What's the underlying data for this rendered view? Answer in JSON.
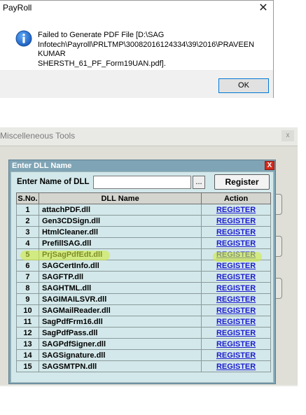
{
  "message_box": {
    "title": "PayRoll",
    "close_glyph": "✕",
    "icon": "info-icon",
    "message_line1": "Failed to Generate PDF File [D:\\SAG",
    "message_line2": "Infotech\\Payroll\\PRLTMP\\30082016124334\\39\\2016\\PRAVEEN KUMAR",
    "message_line3": "SHERSTH_61_PF_Form19UAN.pdf].",
    "ok_label": "OK"
  },
  "misc_window": {
    "title": "Miscelleneous Tools",
    "close_glyph": "x"
  },
  "dll_dialog": {
    "title": "Enter DLL Name",
    "close_glyph": "X",
    "input_label": "Enter Name of DLL",
    "input_value": "",
    "browse_label": "...",
    "register_button_label": "Register",
    "columns": [
      "S.No.",
      "DLL Name",
      "Action"
    ],
    "rows": [
      {
        "sno": "1",
        "name": "attachPDF.dll",
        "action": "REGISTER"
      },
      {
        "sno": "2",
        "name": "Gen3CDSign.dll",
        "action": "REGISTER"
      },
      {
        "sno": "3",
        "name": "HtmlCleaner.dll",
        "action": "REGISTER"
      },
      {
        "sno": "4",
        "name": "PrefillSAG.dll",
        "action": "REGISTER"
      },
      {
        "sno": "5",
        "name": "PrjSagPdfEdt.dll",
        "action": "REGISTER"
      },
      {
        "sno": "6",
        "name": "SAGCertInfo.dll",
        "action": "REGISTER"
      },
      {
        "sno": "7",
        "name": "SAGFTP.dll",
        "action": "REGISTER"
      },
      {
        "sno": "8",
        "name": "SAGHTML.dll",
        "action": "REGISTER"
      },
      {
        "sno": "9",
        "name": "SAGIMAILSVR.dll",
        "action": "REGISTER"
      },
      {
        "sno": "10",
        "name": "SAGMailReader.dll",
        "action": "REGISTER"
      },
      {
        "sno": "11",
        "name": "SagPdfFrm16.dll",
        "action": "REGISTER"
      },
      {
        "sno": "12",
        "name": "SagPdfPass.dll",
        "action": "REGISTER"
      },
      {
        "sno": "13",
        "name": "SAGPdfSigner.dll",
        "action": "REGISTER"
      },
      {
        "sno": "14",
        "name": "SAGSignature.dll",
        "action": "REGISTER"
      },
      {
        "sno": "15",
        "name": "SAGSMTPN.dll",
        "action": "REGISTER"
      }
    ],
    "highlighted_row": "5",
    "highlight_color": "#d2eb3c"
  }
}
